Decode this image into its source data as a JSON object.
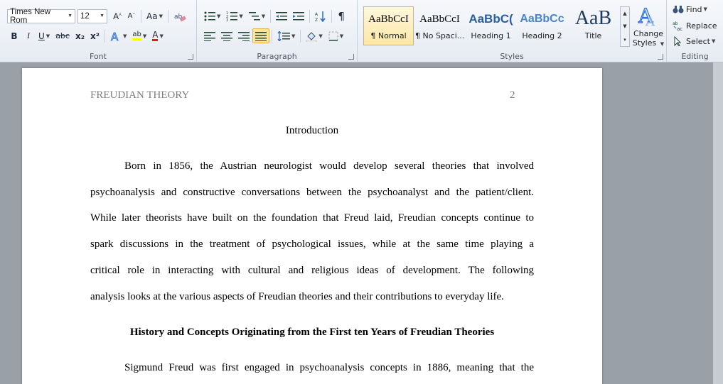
{
  "ribbon": {
    "font": {
      "label": "Font",
      "font_name": "Times New Rom",
      "font_size": "12",
      "grow": "A",
      "shrink": "A",
      "change_case": "Aa",
      "bold": "B",
      "italic": "I",
      "underline": "U",
      "strike": "abc",
      "subscript": "x₂",
      "superscript": "x²",
      "highlight": "ab",
      "color_letter": "A"
    },
    "paragraph": {
      "label": "Paragraph",
      "pilcrow": "¶"
    },
    "styles": {
      "label": "Styles",
      "tiles": [
        {
          "sample": "AaBbCcI",
          "name": "¶ Normal"
        },
        {
          "sample": "AaBbCcI",
          "name": "¶ No Spaci..."
        },
        {
          "sample": "AaBbC(",
          "name": "Heading 1"
        },
        {
          "sample": "AaBbCc",
          "name": "Heading 2"
        },
        {
          "sample": "AaB",
          "name": "Title"
        }
      ],
      "change_styles_line1": "Change",
      "change_styles_line2": "Styles"
    },
    "editing": {
      "label": "Editing",
      "find": "Find",
      "replace": "Replace",
      "select": "Select"
    }
  },
  "document": {
    "header_title": "FREUDIAN THEORY",
    "header_page": "2",
    "intro_heading": "Introduction",
    "para1_lines": [
      "Born in 1856, the Austrian neurologist would develop several theories that involved",
      "psychoanalysis and constructive conversations between the psychoanalyst and the patient/client.",
      "While later theorists have built on the foundation that Freud laid, Freudian concepts continue to",
      "spark discussions in the treatment of psychological issues, while at the same time playing a",
      "critical role in interacting with cultural and religious ideas of development. The following",
      "analysis looks at the various aspects of Freudian theories and their contributions to everyday life."
    ],
    "heading2": "History and Concepts Originating from the First ten Years of Freudian Theories",
    "para2_line1": "Sigmund Freud was first engaged in psychoanalysis concepts in 1886, meaning that the"
  }
}
